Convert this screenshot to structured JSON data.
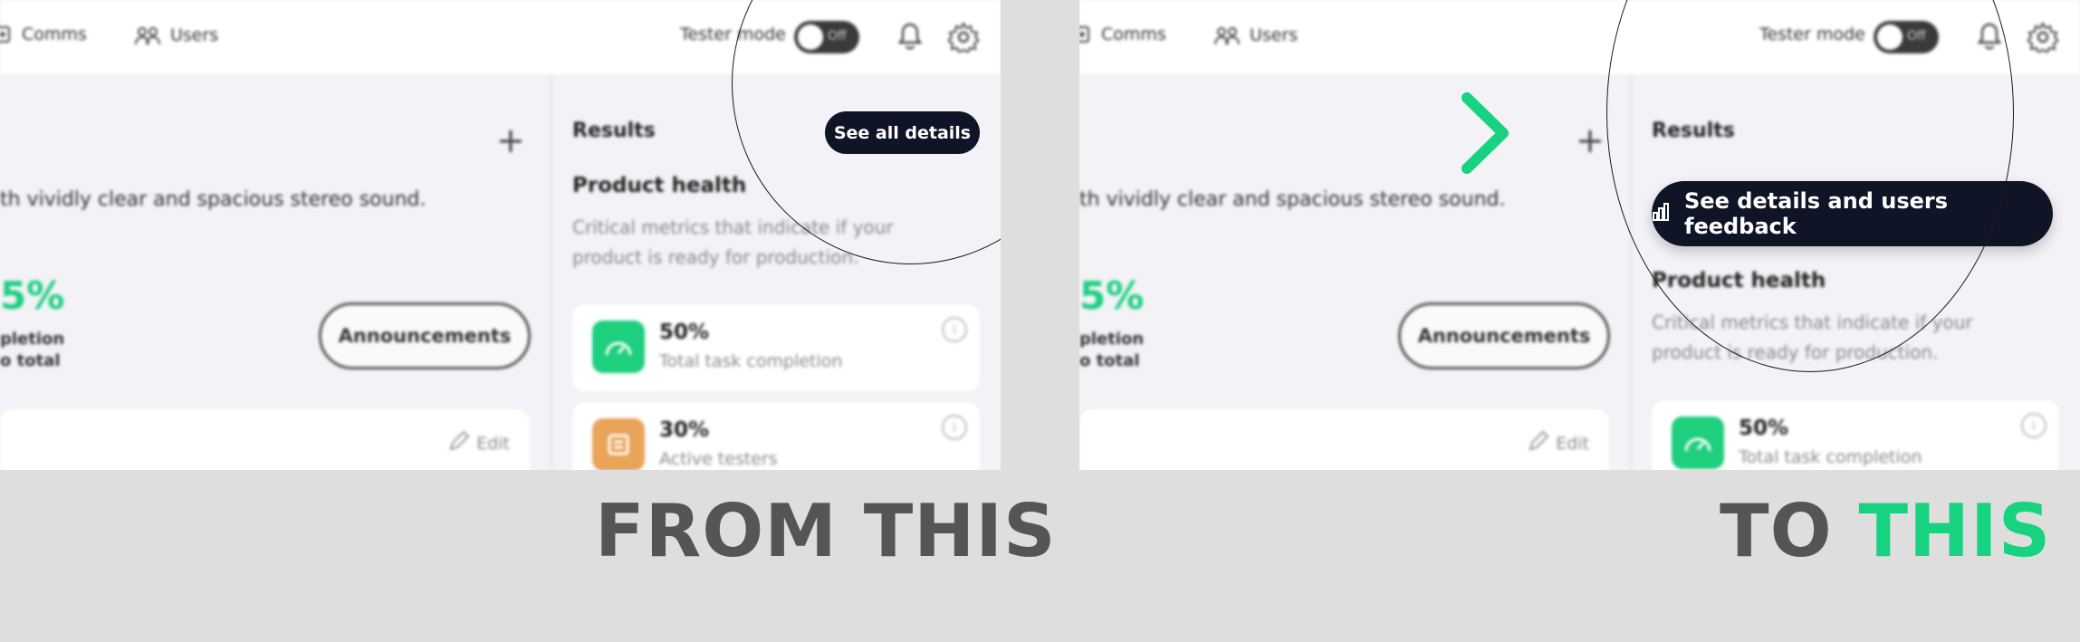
{
  "app": {
    "nav": {
      "comms_label": "Comms",
      "users_label": "Users"
    },
    "tester_mode_label": "Tester mode",
    "toggle_state": "Off",
    "plus_label": "+",
    "description": "th vividly clear and spacious stereo sound.",
    "completion_pct": "5%",
    "completion_sub1": "pletion",
    "completion_sub2": "o total",
    "announcements_label": "Announcements",
    "edit_label": "Edit",
    "results_title": "Results",
    "product_health_title": "Product health",
    "product_health_desc": "Critical metrics that indicate if your product is ready for production.",
    "metrics": [
      {
        "value": "50%",
        "label": "Total task completion",
        "color": "#1ecf7e"
      },
      {
        "value": "30%",
        "label": "Active testers",
        "color": "#e9a45a"
      }
    ],
    "info_glyph": "i"
  },
  "before": {
    "button_label": "See all details"
  },
  "after": {
    "button_label": "See details and users feedback",
    "button_icon": "bar-chart-icon"
  },
  "captions": {
    "from": "FROM THIS",
    "to_prefix": "TO",
    "to_accent": "THIS"
  },
  "colors": {
    "accent_green": "#17d27f",
    "dark_button": "#0f1526",
    "panel_bg": "#f2f2f7",
    "page_bg": "#dedede",
    "caption_gray": "#555555"
  }
}
